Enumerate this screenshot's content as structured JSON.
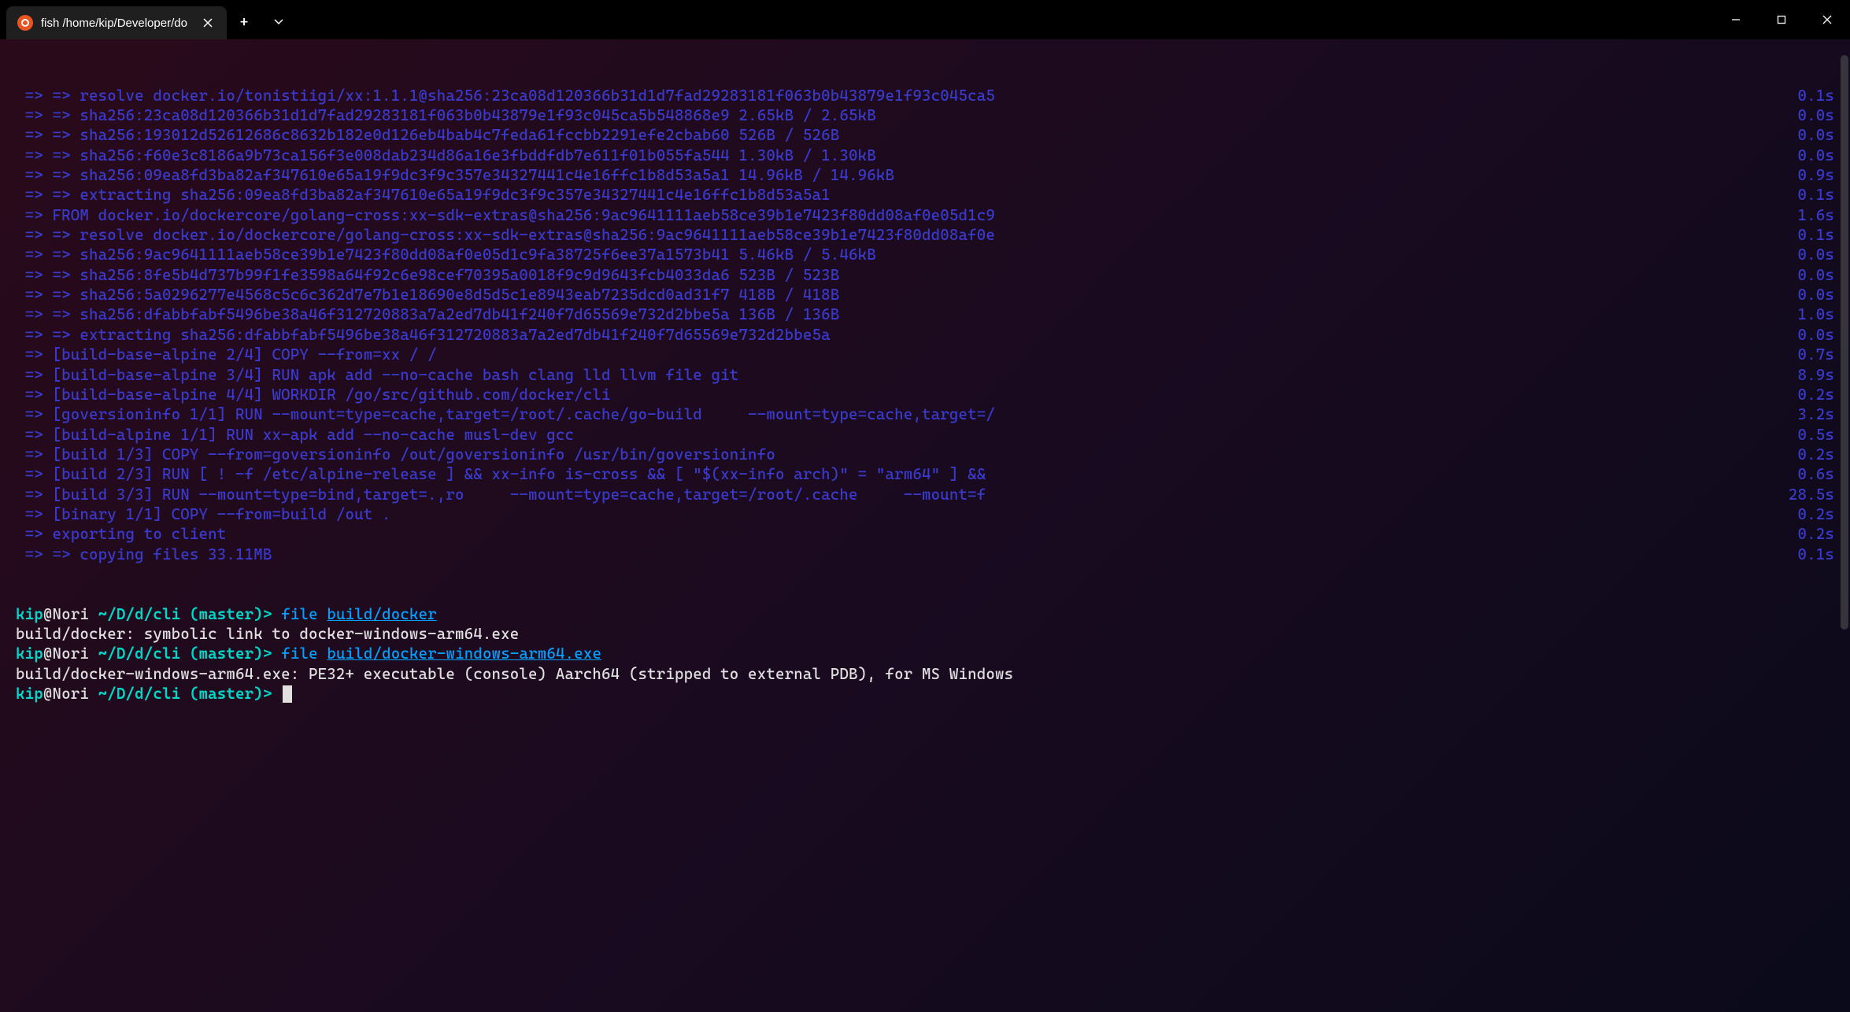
{
  "titlebar": {
    "tab_title": "fish /home/kip/Developer/do",
    "new_tab": "+",
    "dropdown": "⌄"
  },
  "build_lines": [
    {
      "left": " => => resolve docker.io/tonistiigi/xx:1.1.1@sha256:23ca08d120366b31d1d7fad29283181f063b0b43879e1f93c045ca5",
      "right": "0.1s"
    },
    {
      "left": " => => sha256:23ca08d120366b31d1d7fad29283181f063b0b43879e1f93c045ca5b548868e9 2.65kB / 2.65kB",
      "right": "0.0s"
    },
    {
      "left": " => => sha256:193012d52612686c8632b182e0d126eb4bab4c7feda61fccbb2291efe2cbab60 526B / 526B",
      "right": "0.0s"
    },
    {
      "left": " => => sha256:f60e3c8186a9b73ca156f3e008dab234d86a16e3fbddfdb7e611f01b055fa544 1.30kB / 1.30kB",
      "right": "0.0s"
    },
    {
      "left": " => => sha256:09ea8fd3ba82af347610e65a19f9dc3f9c357e34327441c4e16ffc1b8d53a5a1 14.96kB / 14.96kB",
      "right": "0.9s"
    },
    {
      "left": " => => extracting sha256:09ea8fd3ba82af347610e65a19f9dc3f9c357e34327441c4e16ffc1b8d53a5a1",
      "right": "0.1s"
    },
    {
      "left": " => FROM docker.io/dockercore/golang-cross:xx-sdk-extras@sha256:9ac9641111aeb58ce39b1e7423f80dd08af0e05d1c9",
      "right": "1.6s"
    },
    {
      "left": " => => resolve docker.io/dockercore/golang-cross:xx-sdk-extras@sha256:9ac9641111aeb58ce39b1e7423f80dd08af0e",
      "right": "0.1s"
    },
    {
      "left": " => => sha256:9ac9641111aeb58ce39b1e7423f80dd08af0e05d1c9fa38725f6ee37a1573b41 5.46kB / 5.46kB",
      "right": "0.0s"
    },
    {
      "left": " => => sha256:8fe5b4d737b99f1fe3598a64f92c6e98cef70395a0018f9c9d9643fcb4033da6 523B / 523B",
      "right": "0.0s"
    },
    {
      "left": " => => sha256:5a0296277e4568c5c6c362d7e7b1e18690e8d5d5c1e8943eab7235dcd0ad31f7 418B / 418B",
      "right": "0.0s"
    },
    {
      "left": " => => sha256:dfabbfabf5496be38a46f312720883a7a2ed7db41f240f7d65569e732d2bbe5a 136B / 136B",
      "right": "1.0s"
    },
    {
      "left": " => => extracting sha256:dfabbfabf5496be38a46f312720883a7a2ed7db41f240f7d65569e732d2bbe5a",
      "right": "0.0s"
    },
    {
      "left": " => [build-base-alpine 2/4] COPY --from=xx / /",
      "right": "0.7s"
    },
    {
      "left": " => [build-base-alpine 3/4] RUN apk add --no-cache bash clang lld llvm file git",
      "right": "8.9s"
    },
    {
      "left": " => [build-base-alpine 4/4] WORKDIR /go/src/github.com/docker/cli",
      "right": "0.2s"
    },
    {
      "left": " => [goversioninfo 1/1] RUN --mount=type=cache,target=/root/.cache/go-build     --mount=type=cache,target=/",
      "right": "3.2s"
    },
    {
      "left": " => [build-alpine 1/1] RUN xx-apk add --no-cache musl-dev gcc",
      "right": "0.5s"
    },
    {
      "left": " => [build 1/3] COPY --from=goversioninfo /out/goversioninfo /usr/bin/goversioninfo",
      "right": "0.2s"
    },
    {
      "left": " => [build 2/3] RUN [ ! -f /etc/alpine-release ] && xx-info is-cross && [ \"$(xx-info arch)\" = \"arm64\" ] &&",
      "right": "0.6s"
    },
    {
      "left": " => [build 3/3] RUN --mount=type=bind,target=.,ro     --mount=type=cache,target=/root/.cache     --mount=f",
      "right": "28.5s"
    },
    {
      "left": " => [binary 1/1] COPY --from=build /out .",
      "right": "0.2s"
    },
    {
      "left": " => exporting to client",
      "right": "0.2s"
    },
    {
      "left": " => => copying files 33.11MB",
      "right": "0.1s"
    }
  ],
  "prompts": [
    {
      "user": "kip",
      "at": "@Nori",
      "path": " ~/D/d/cli ",
      "branch": "(master)",
      "sep": "> ",
      "cmd": "file ",
      "arg": "build/docker"
    },
    {
      "output": "build/docker: symbolic link to docker-windows-arm64.exe"
    },
    {
      "user": "kip",
      "at": "@Nori",
      "path": " ~/D/d/cli ",
      "branch": "(master)",
      "sep": "> ",
      "cmd": "file ",
      "arg": "build/docker-windows-arm64.exe"
    },
    {
      "output": "build/docker-windows-arm64.exe: PE32+ executable (console) Aarch64 (stripped to external PDB), for MS Windows"
    },
    {
      "user": "kip",
      "at": "@Nori",
      "path": " ~/D/d/cli ",
      "branch": "(master)",
      "sep": "> ",
      "cursor": true
    }
  ]
}
